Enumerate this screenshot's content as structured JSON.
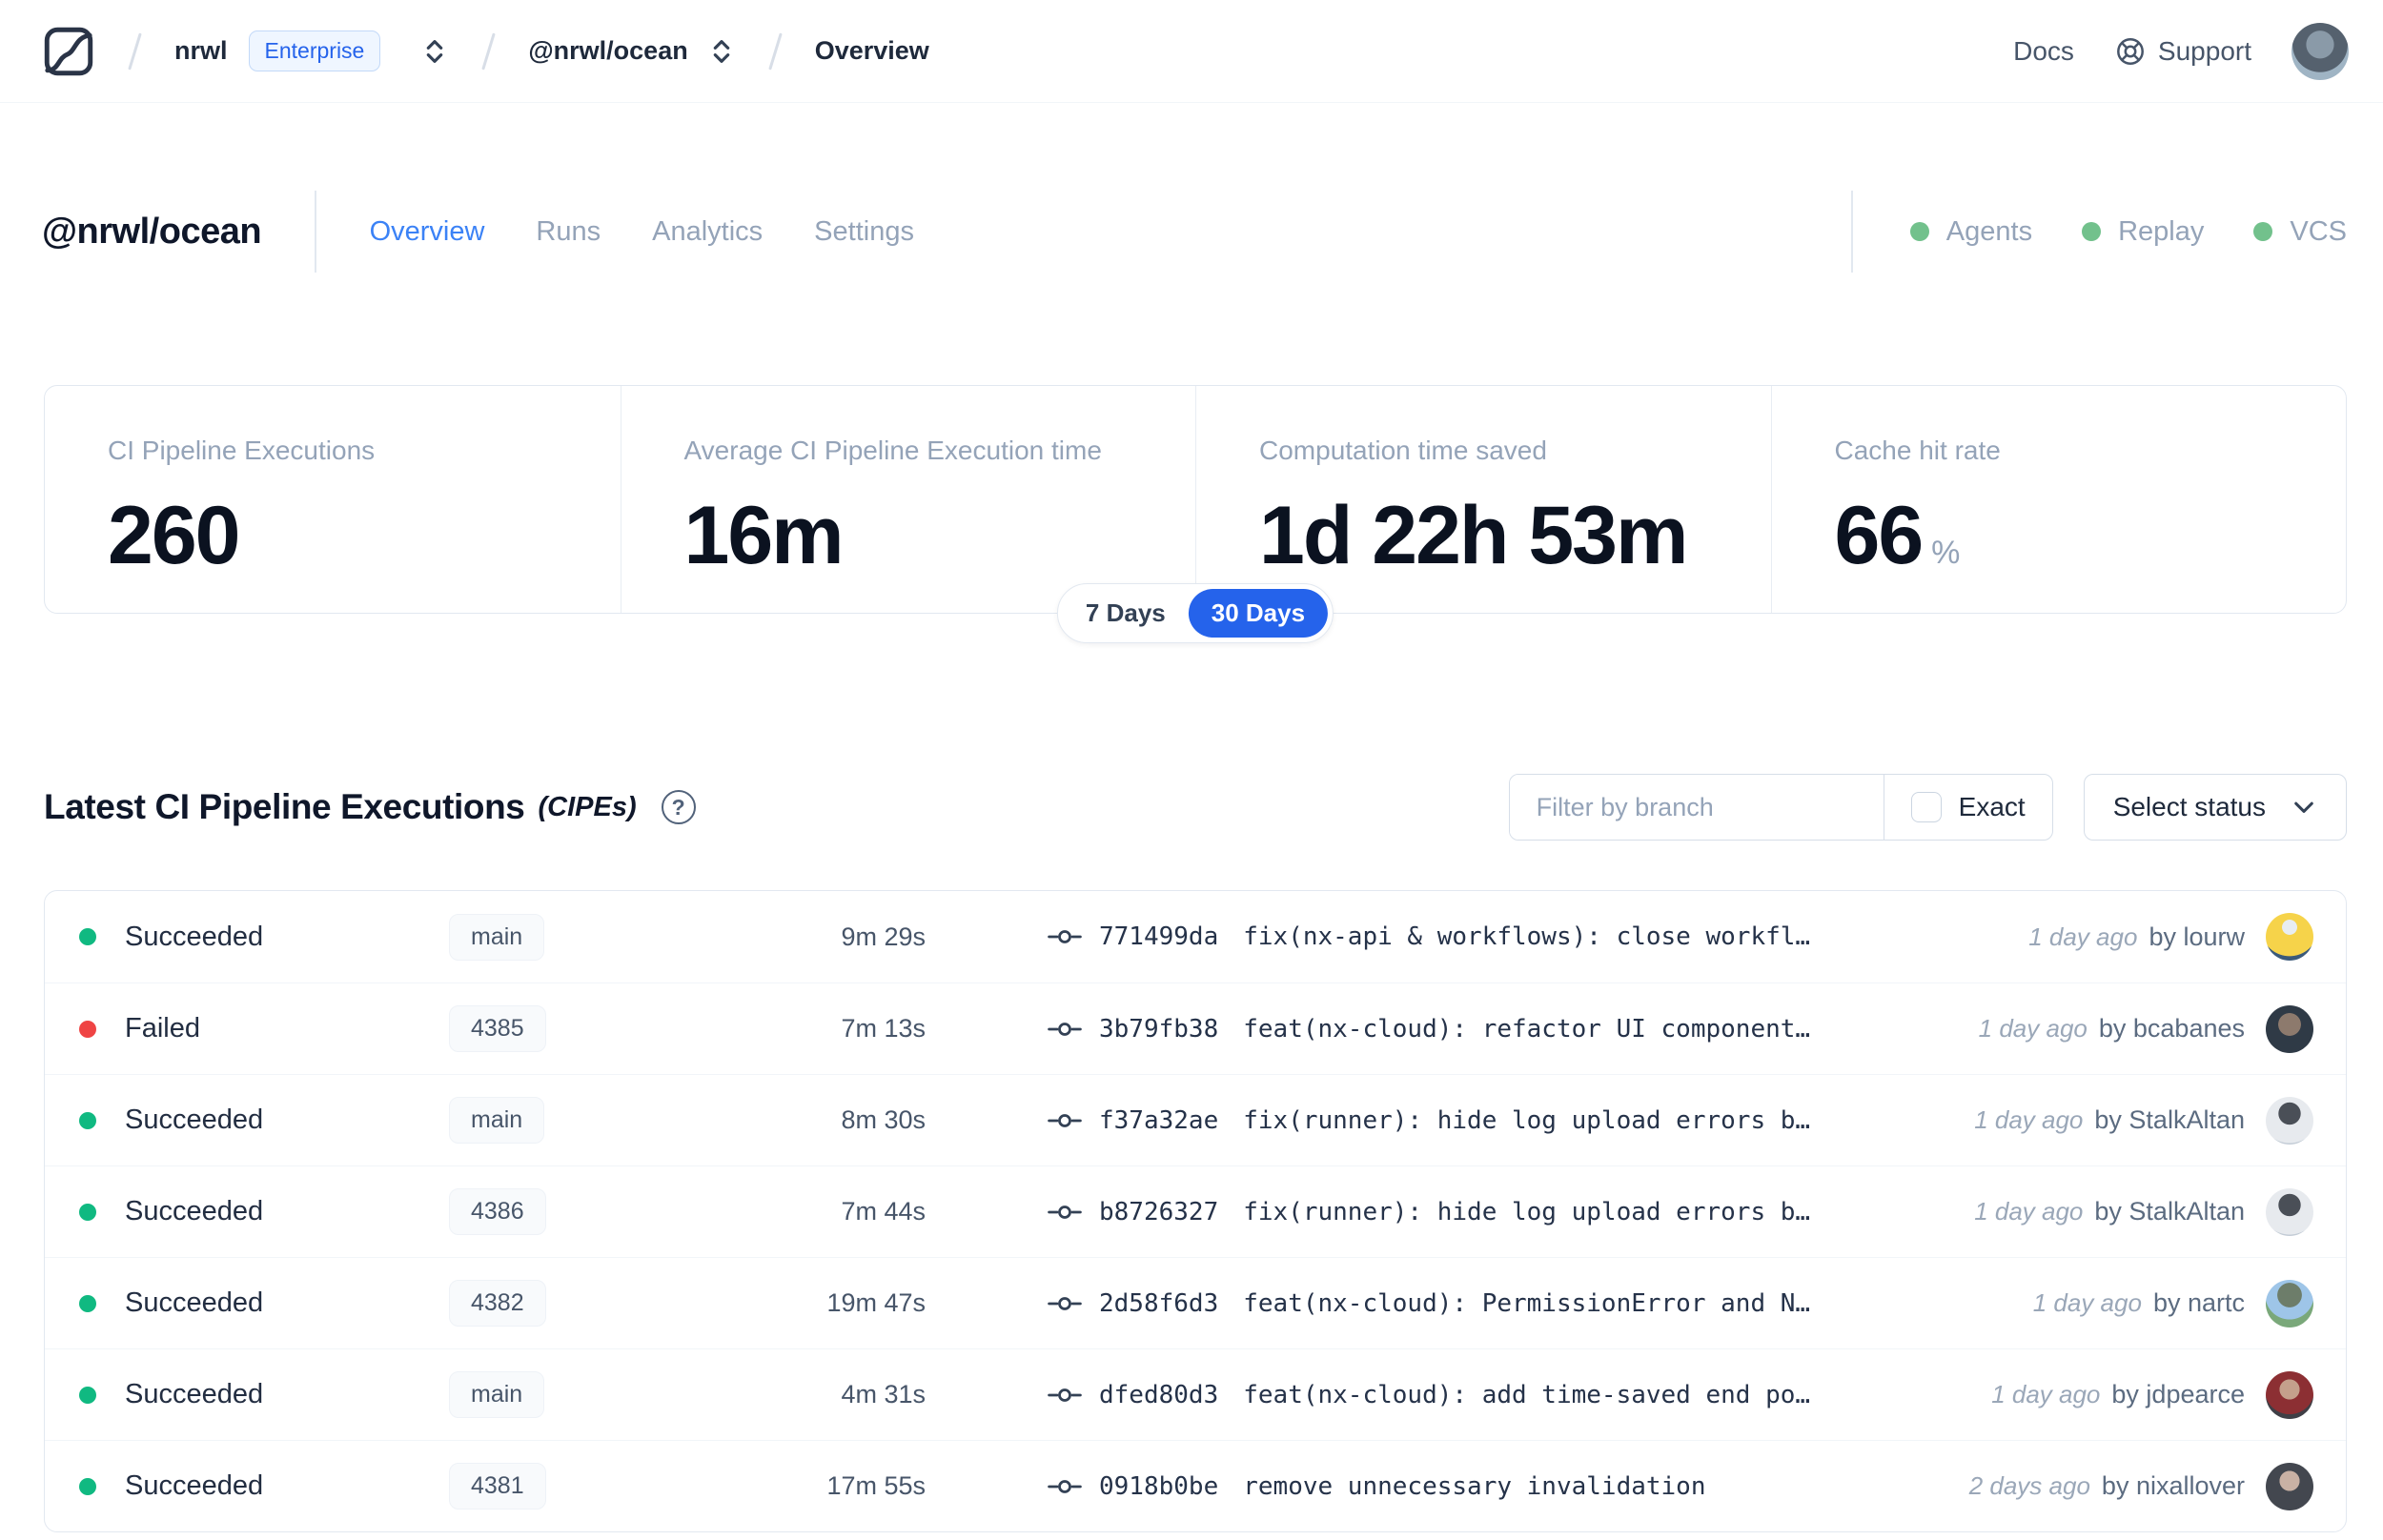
{
  "nav": {
    "breadcrumb": {
      "org": "nrwl",
      "org_badge": "Enterprise",
      "workspace": "@nrwl/ocean",
      "page": "Overview"
    },
    "docs_label": "Docs",
    "support_label": "Support"
  },
  "header": {
    "title": "@nrwl/ocean",
    "tabs": [
      {
        "label": "Overview",
        "active": true
      },
      {
        "label": "Runs",
        "active": false
      },
      {
        "label": "Analytics",
        "active": false
      },
      {
        "label": "Settings",
        "active": false
      }
    ],
    "health_indicators": [
      {
        "label": "Agents"
      },
      {
        "label": "Replay"
      },
      {
        "label": "VCS"
      }
    ],
    "health_dot_color": "#72c18c"
  },
  "stats": {
    "cards": [
      {
        "label": "CI Pipeline Executions",
        "value": "260",
        "suffix": ""
      },
      {
        "label": "Average CI Pipeline Execution time",
        "value": "16m",
        "suffix": ""
      },
      {
        "label": "Computation time saved",
        "value": "1d 22h 53m",
        "suffix": ""
      },
      {
        "label": "Cache hit rate",
        "value": "66",
        "suffix": "%"
      }
    ],
    "range_toggle": {
      "options": [
        "7 Days",
        "30 Days"
      ],
      "selected": "30 Days",
      "selected_color": "#2563eb"
    }
  },
  "cipes": {
    "title": "Latest CI Pipeline Executions",
    "suffix": "(CIPEs)",
    "icons": {
      "help_glyph": "?"
    },
    "filter": {
      "placeholder": "Filter by branch",
      "exact_label": "Exact",
      "exact_checked": false
    },
    "status_select_label": "Select status",
    "status_colors": {
      "succeeded": "#10b981",
      "failed": "#ef4444"
    },
    "rows": [
      {
        "status": "Succeeded",
        "branch": "main",
        "duration": "9m 29s",
        "commit_hash": "771499da",
        "commit_message": "fix(nx-api & workflows): close workfl…",
        "time": "1 day ago",
        "author": "by lourw"
      },
      {
        "status": "Failed",
        "branch": "4385",
        "duration": "7m 13s",
        "commit_hash": "3b79fb38",
        "commit_message": "feat(nx-cloud): refactor UI component…",
        "time": "1 day ago",
        "author": "by bcabanes"
      },
      {
        "status": "Succeeded",
        "branch": "main",
        "duration": "8m 30s",
        "commit_hash": "f37a32ae",
        "commit_message": "fix(runner): hide log upload errors b…",
        "time": "1 day ago",
        "author": "by StalkAltan"
      },
      {
        "status": "Succeeded",
        "branch": "4386",
        "duration": "7m 44s",
        "commit_hash": "b8726327",
        "commit_message": "fix(runner): hide log upload errors b…",
        "time": "1 day ago",
        "author": "by StalkAltan"
      },
      {
        "status": "Succeeded",
        "branch": "4382",
        "duration": "19m 47s",
        "commit_hash": "2d58f6d3",
        "commit_message": "feat(nx-cloud): PermissionError and N…",
        "time": "1 day ago",
        "author": "by nartc"
      },
      {
        "status": "Succeeded",
        "branch": "main",
        "duration": "4m 31s",
        "commit_hash": "dfed80d3",
        "commit_message": "feat(nx-cloud): add time-saved end po…",
        "time": "1 day ago",
        "author": "by jdpearce"
      },
      {
        "status": "Succeeded",
        "branch": "4381",
        "duration": "17m 55s",
        "commit_hash": "0918b0be",
        "commit_message": "remove unnecessary invalidation",
        "time": "2 days ago",
        "author": "by nixallover"
      }
    ]
  }
}
